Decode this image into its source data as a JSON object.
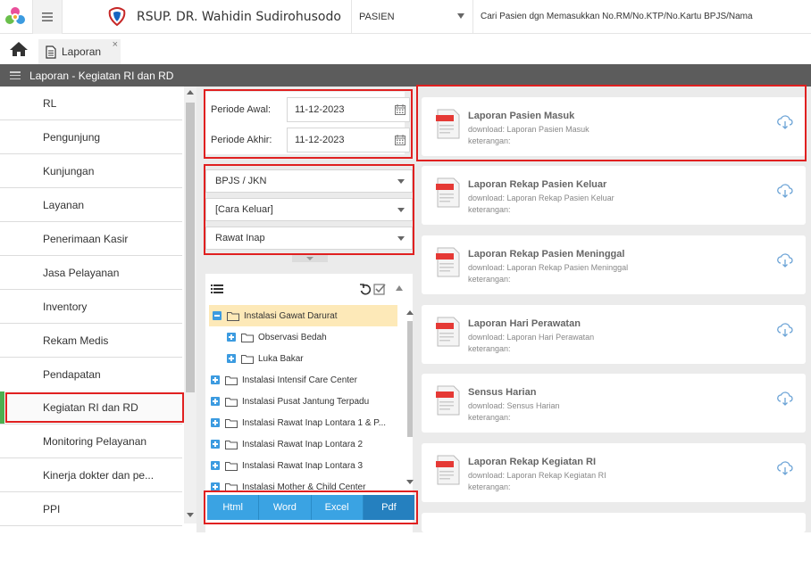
{
  "topbar": {
    "hospital_name": "RSUP. DR. Wahidin Sudirohusodo",
    "patient_type": "PASIEN",
    "search_hint": "Cari Pasien dgn Memasukkan No.RM/No.KTP/No.Kartu BPJS/Nama"
  },
  "tabs": [
    {
      "label": "Laporan",
      "close": "×"
    }
  ],
  "section": {
    "title": "Laporan - Kegiatan RI dan RD"
  },
  "sidebar": {
    "items": [
      {
        "label": "RL"
      },
      {
        "label": "Pengunjung"
      },
      {
        "label": "Kunjungan"
      },
      {
        "label": "Layanan"
      },
      {
        "label": "Penerimaan Kasir"
      },
      {
        "label": "Jasa Pelayanan"
      },
      {
        "label": "Inventory"
      },
      {
        "label": "Rekam Medis"
      },
      {
        "label": "Pendapatan"
      },
      {
        "label": "Kegiatan RI dan RD"
      },
      {
        "label": "Monitoring Pelayanan"
      },
      {
        "label": "Kinerja dokter dan pe..."
      },
      {
        "label": "PPI"
      }
    ],
    "active_index": 9
  },
  "period": {
    "start_label": "Periode Awal:",
    "start_value": "11-12-2023",
    "end_label": "Periode Akhir:",
    "end_value": "11-12-2023"
  },
  "filters": {
    "payer": "BPJS / JKN",
    "discharge": "[Cara Keluar]",
    "care_type": "Rawat Inap"
  },
  "tree": {
    "nodes": [
      {
        "label": "Instalasi Gawat Darurat",
        "level": 0,
        "expanded": true,
        "selected": true
      },
      {
        "label": "Observasi Bedah",
        "level": 1,
        "expanded": false,
        "selected": false
      },
      {
        "label": "Luka Bakar",
        "level": 1,
        "expanded": false,
        "selected": false
      },
      {
        "label": "Instalasi Intensif Care Center",
        "level": 0,
        "expanded": false,
        "selected": false
      },
      {
        "label": "Instalasi Pusat Jantung Terpadu",
        "level": 0,
        "expanded": false,
        "selected": false
      },
      {
        "label": "Instalasi Rawat Inap Lontara 1 & P...",
        "level": 0,
        "expanded": false,
        "selected": false
      },
      {
        "label": "Instalasi Rawat Inap Lontara 2",
        "level": 0,
        "expanded": false,
        "selected": false
      },
      {
        "label": "Instalasi Rawat Inap Lontara 3",
        "level": 0,
        "expanded": false,
        "selected": false
      },
      {
        "label": "Instalasi Mother & Child Center",
        "level": 0,
        "expanded": false,
        "selected": false
      }
    ]
  },
  "export": {
    "html": "Html",
    "word": "Word",
    "excel": "Excel",
    "pdf": "Pdf"
  },
  "reports": [
    {
      "title": "Laporan Pasien Masuk",
      "download": "download: Laporan Pasien Masuk",
      "note": "keterangan:"
    },
    {
      "title": "Laporan Rekap Pasien Keluar",
      "download": "download: Laporan Rekap Pasien Keluar",
      "note": "keterangan:"
    },
    {
      "title": "Laporan Rekap Pasien Meninggal",
      "download": "download: Laporan Rekap Pasien Meninggal",
      "note": "keterangan:"
    },
    {
      "title": "Laporan Hari Perawatan",
      "download": "download: Laporan Hari Perawatan",
      "note": "keterangan:"
    },
    {
      "title": "Sensus Harian",
      "download": "download: Sensus Harian",
      "note": "keterangan:"
    },
    {
      "title": "Laporan Rekap Kegiatan RI",
      "download": "download: Laporan Rekap Kegiatan RI",
      "note": "keterangan:"
    }
  ],
  "colors": {
    "header_gray": "#5c5c5c",
    "accent_green": "#4caf50",
    "button_blue": "#3aa3e3",
    "button_blue_active": "#2580bf",
    "highlight_red": "#e02020",
    "selected_row": "#fde9b8"
  },
  "icons": {
    "app_logo": "app-logo-icon",
    "menu": "hamburger-icon",
    "hospital_logo": "hospital-logo-icon",
    "home": "home-icon",
    "document": "document-icon",
    "calendar": "calendar-icon",
    "list": "list-icon",
    "undo": "undo-icon",
    "check": "checkbox-icon",
    "folder": "folder-icon",
    "pdf": "pdf-file-icon",
    "cloud": "cloud-download-icon"
  }
}
